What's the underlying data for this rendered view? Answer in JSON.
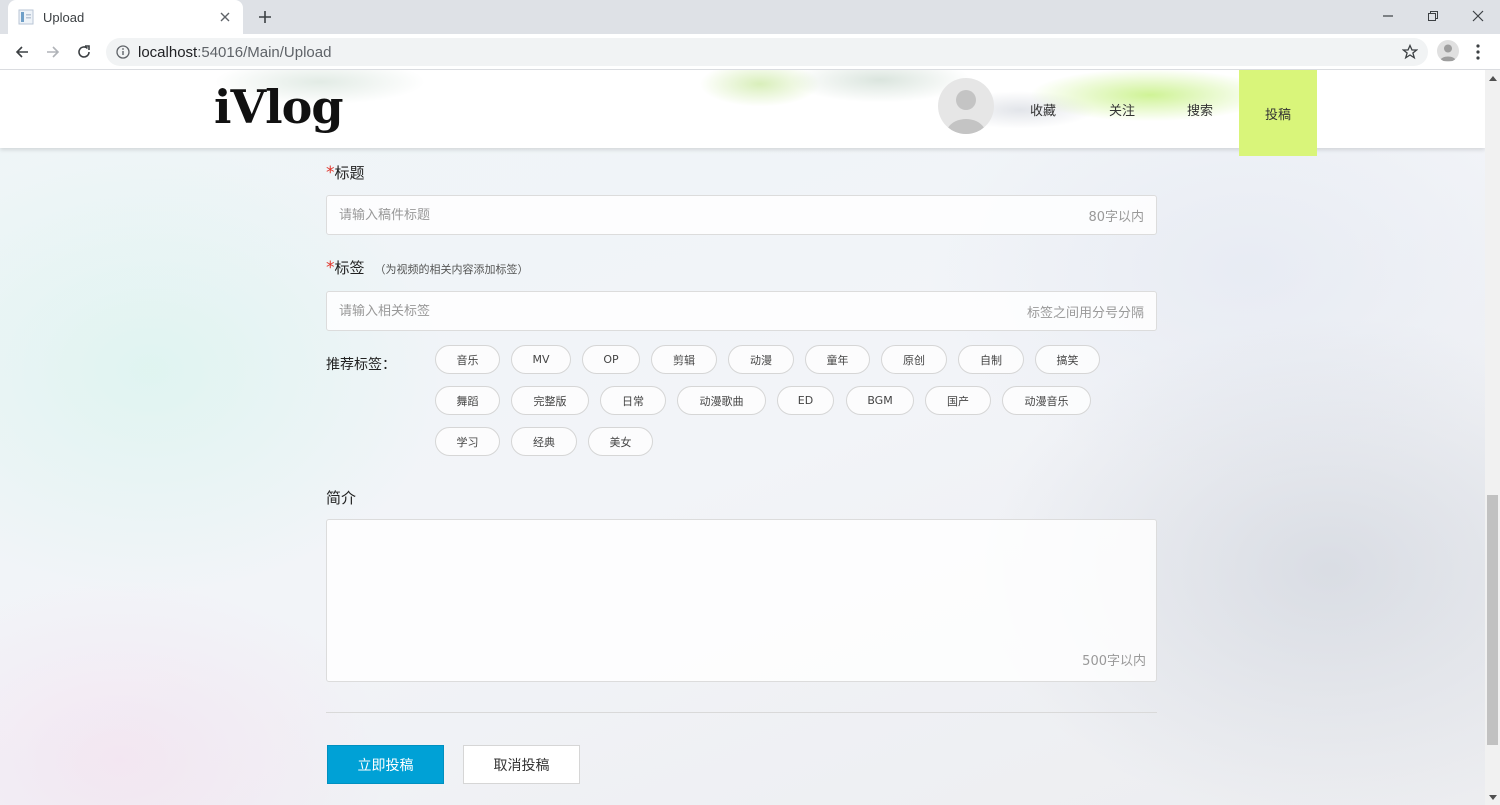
{
  "browser": {
    "tab_title": "Upload",
    "url_host": "localhost",
    "url_rest": ":54016/Main/Upload"
  },
  "header": {
    "logo": "iVlog",
    "nav": [
      "收藏",
      "关注",
      "搜索",
      "投稿"
    ],
    "active_nav": "投稿",
    "active_color": "#d9f57a"
  },
  "form": {
    "title": {
      "required_mark": "*",
      "label": "标题",
      "placeholder": "请输入稿件标题",
      "limit": "80字以内"
    },
    "tags": {
      "required_mark": "*",
      "label": "标签",
      "hint": "（为视频的相关内容添加标签）",
      "placeholder": "请输入相关标签",
      "limit": "标签之间用分号分隔"
    },
    "recommended": {
      "label": "推荐标签：",
      "rows": [
        [
          "音乐",
          "MV",
          "OP",
          "剪辑",
          "动漫",
          "童年",
          "原创",
          "自制",
          "搞笑"
        ],
        [
          "舞蹈",
          "完整版",
          "日常",
          "动漫歌曲",
          "ED",
          "BGM",
          "国产",
          "动漫音乐"
        ],
        [
          "学习",
          "经典",
          "美女"
        ]
      ]
    },
    "intro": {
      "label": "简介",
      "limit": "500字以内"
    },
    "submit_label": "立即投稿",
    "cancel_label": "取消投稿",
    "primary_color": "#00a1d6"
  }
}
